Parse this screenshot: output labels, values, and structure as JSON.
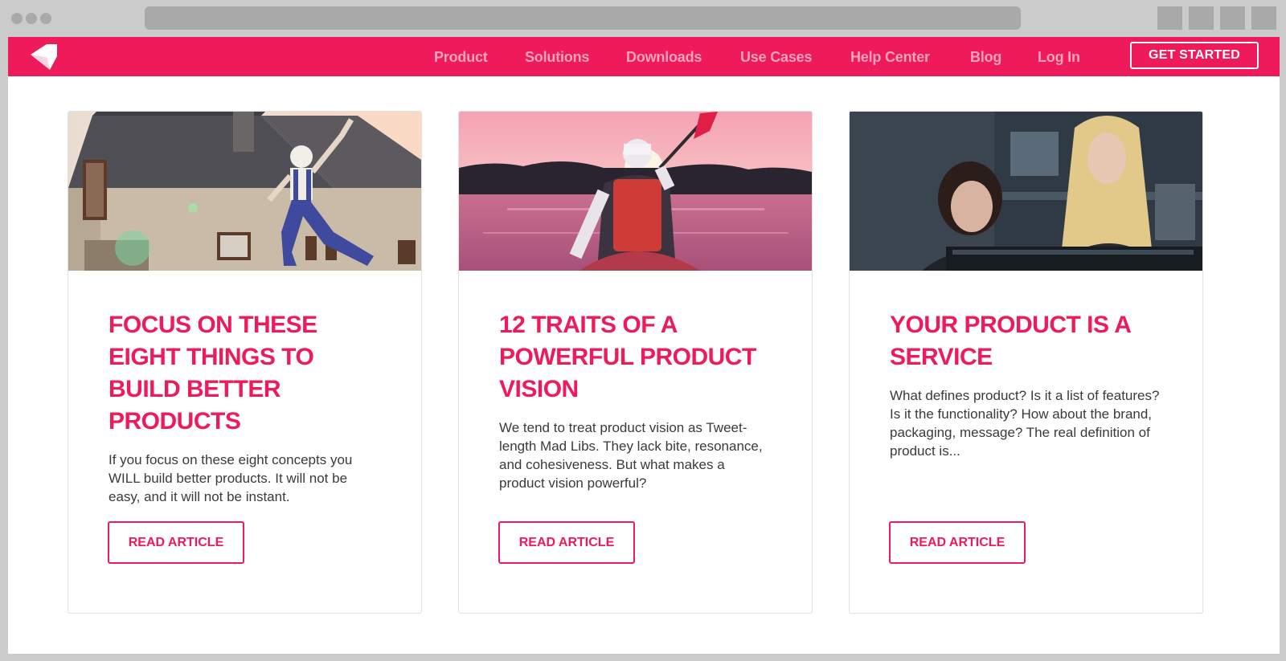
{
  "nav": {
    "links": [
      "Product",
      "Solutions",
      "Downloads",
      "Use Cases",
      "Help Center",
      "Blog",
      "Log In"
    ],
    "cta_label": "GET STARTED"
  },
  "colors": {
    "brand": "#ee1a5a",
    "nav_link": "#f9a3bd",
    "text": "#3a3a3a"
  },
  "cards": [
    {
      "image": "house-jumping-worker",
      "title": "FOCUS ON THESE EIGHT THINGS TO BUILD BETTER PRODUCTS",
      "excerpt": "If you focus on these eight concepts you WILL build better products. It will not be easy, and it will not be instant.",
      "button": "READ ARTICLE"
    },
    {
      "image": "kayaker-sunset",
      "title": "12 TRAITS OF A POWERFUL PRODUCT VISION",
      "excerpt": "We tend to treat product vision as Tweet-length Mad Libs. They lack bite, resonance, and cohesiveness. But what makes a product vision powerful?",
      "button": "READ ARTICLE"
    },
    {
      "image": "women-at-computer",
      "title": "YOUR PRODUCT IS A SERVICE",
      "excerpt": "What defines product? Is it a list of features? Is it the functionality? How about the brand, packaging, message? The real definition of product is...",
      "button": "READ ARTICLE"
    }
  ]
}
